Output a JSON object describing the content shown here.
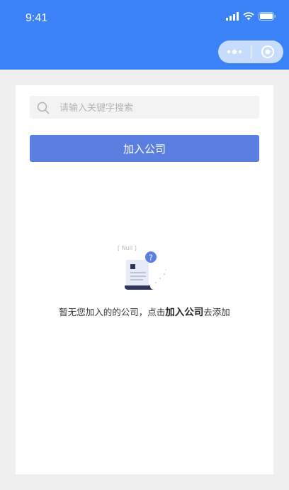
{
  "status_bar": {
    "time": "9:41"
  },
  "search": {
    "placeholder": "请输入关键字搜索"
  },
  "join_button": {
    "label": "加入公司"
  },
  "empty_state": {
    "null_tag": "[ Null ]",
    "question_mark": "?",
    "message_prefix": "暂无您加入的的公司，点击",
    "message_link": "加入公司",
    "message_suffix": "去添加"
  },
  "colors": {
    "header_bg": "#3b82f6",
    "primary_button": "#5b7fe0",
    "page_bg": "#efefef"
  }
}
